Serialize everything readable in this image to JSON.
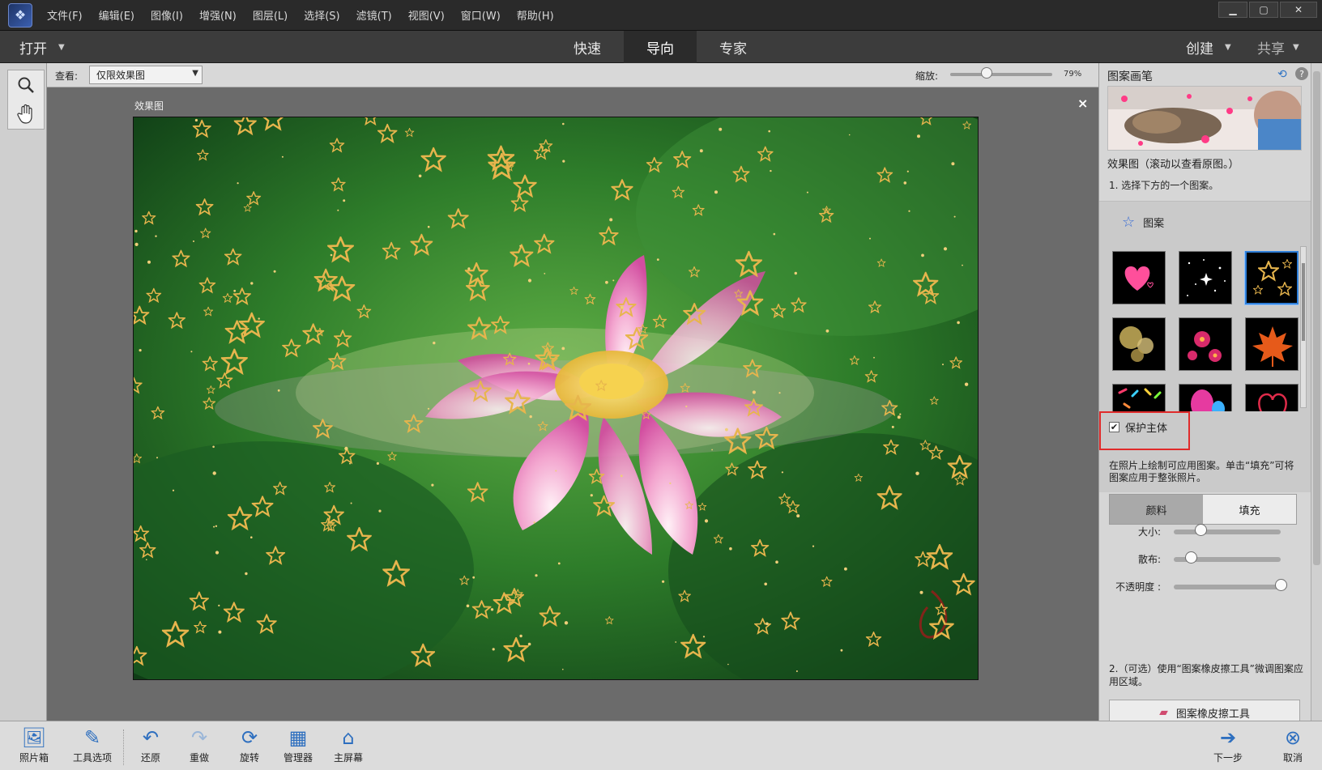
{
  "menubar": {
    "items": [
      "文件(F)",
      "编辑(E)",
      "图像(I)",
      "增强(N)",
      "图层(L)",
      "选择(S)",
      "滤镜(T)",
      "视图(V)",
      "窗口(W)",
      "帮助(H)"
    ]
  },
  "modebar": {
    "open_label": "打开",
    "tabs": [
      {
        "label": "快速",
        "active": false
      },
      {
        "label": "导向",
        "active": true
      },
      {
        "label": "专家",
        "active": false
      }
    ],
    "create_label": "创建",
    "share_label": "共享"
  },
  "options": {
    "view_label": "查看:",
    "view_value": "仅限效果图",
    "zoom_label": "缩放:",
    "zoom_value": "79%",
    "zoom_level": 0.36
  },
  "canvas": {
    "label": "效果图",
    "close_symbol": "×"
  },
  "panel": {
    "title": "图案画笔",
    "preview_caption": "效果图（滚动以查看原图。）",
    "step1": "1. 选择下方的一个图案。",
    "pattern_header": "图案",
    "patterns": [
      {
        "name": "hearts",
        "selected": false
      },
      {
        "name": "sparkles",
        "selected": false
      },
      {
        "name": "stars",
        "selected": true
      },
      {
        "name": "bokeh",
        "selected": false
      },
      {
        "name": "flowers",
        "selected": false
      },
      {
        "name": "leaf",
        "selected": false
      },
      {
        "name": "confetti",
        "selected": false
      },
      {
        "name": "balloons",
        "selected": false
      },
      {
        "name": "heart-outline",
        "selected": false
      }
    ],
    "protect_label": "保护主体",
    "protect_checked": true,
    "protect_desc": "在照片上绘制可应用图案。单击“填充”可将图案应用于整张照片。",
    "mode_buttons": [
      {
        "label": "颜料",
        "active": true
      },
      {
        "label": "填充",
        "active": false
      }
    ],
    "sliders": [
      {
        "label": "大小:",
        "value": 0.25
      },
      {
        "label": "散布:",
        "value": 0.16
      },
      {
        "label": "不透明度 :",
        "value": 1.0
      }
    ],
    "step2": "2.（可选）使用“图案橡皮擦工具”微调图案应用区域。",
    "eraser_label": "图案橡皮擦工具"
  },
  "taskbar": {
    "items": [
      {
        "label": "照片箱",
        "icon": "photo-bin-icon"
      },
      {
        "label": "工具选项",
        "icon": "tool-options-icon"
      },
      {
        "label": "还原",
        "icon": "undo-icon"
      },
      {
        "label": "重做",
        "icon": "redo-icon"
      },
      {
        "label": "旋转",
        "icon": "rotate-icon"
      },
      {
        "label": "管理器",
        "icon": "organizer-icon"
      },
      {
        "label": "主屏幕",
        "icon": "home-icon"
      },
      {
        "label": "下一步",
        "icon": "next-arrow-icon"
      },
      {
        "label": "取消",
        "icon": "cancel-icon"
      }
    ]
  },
  "colors": {
    "accent_blue": "#2f7fd9",
    "highlight_red": "#e02b2b",
    "menubar_bg": "#2a2a2a",
    "star_gold": "#e0b24a"
  }
}
